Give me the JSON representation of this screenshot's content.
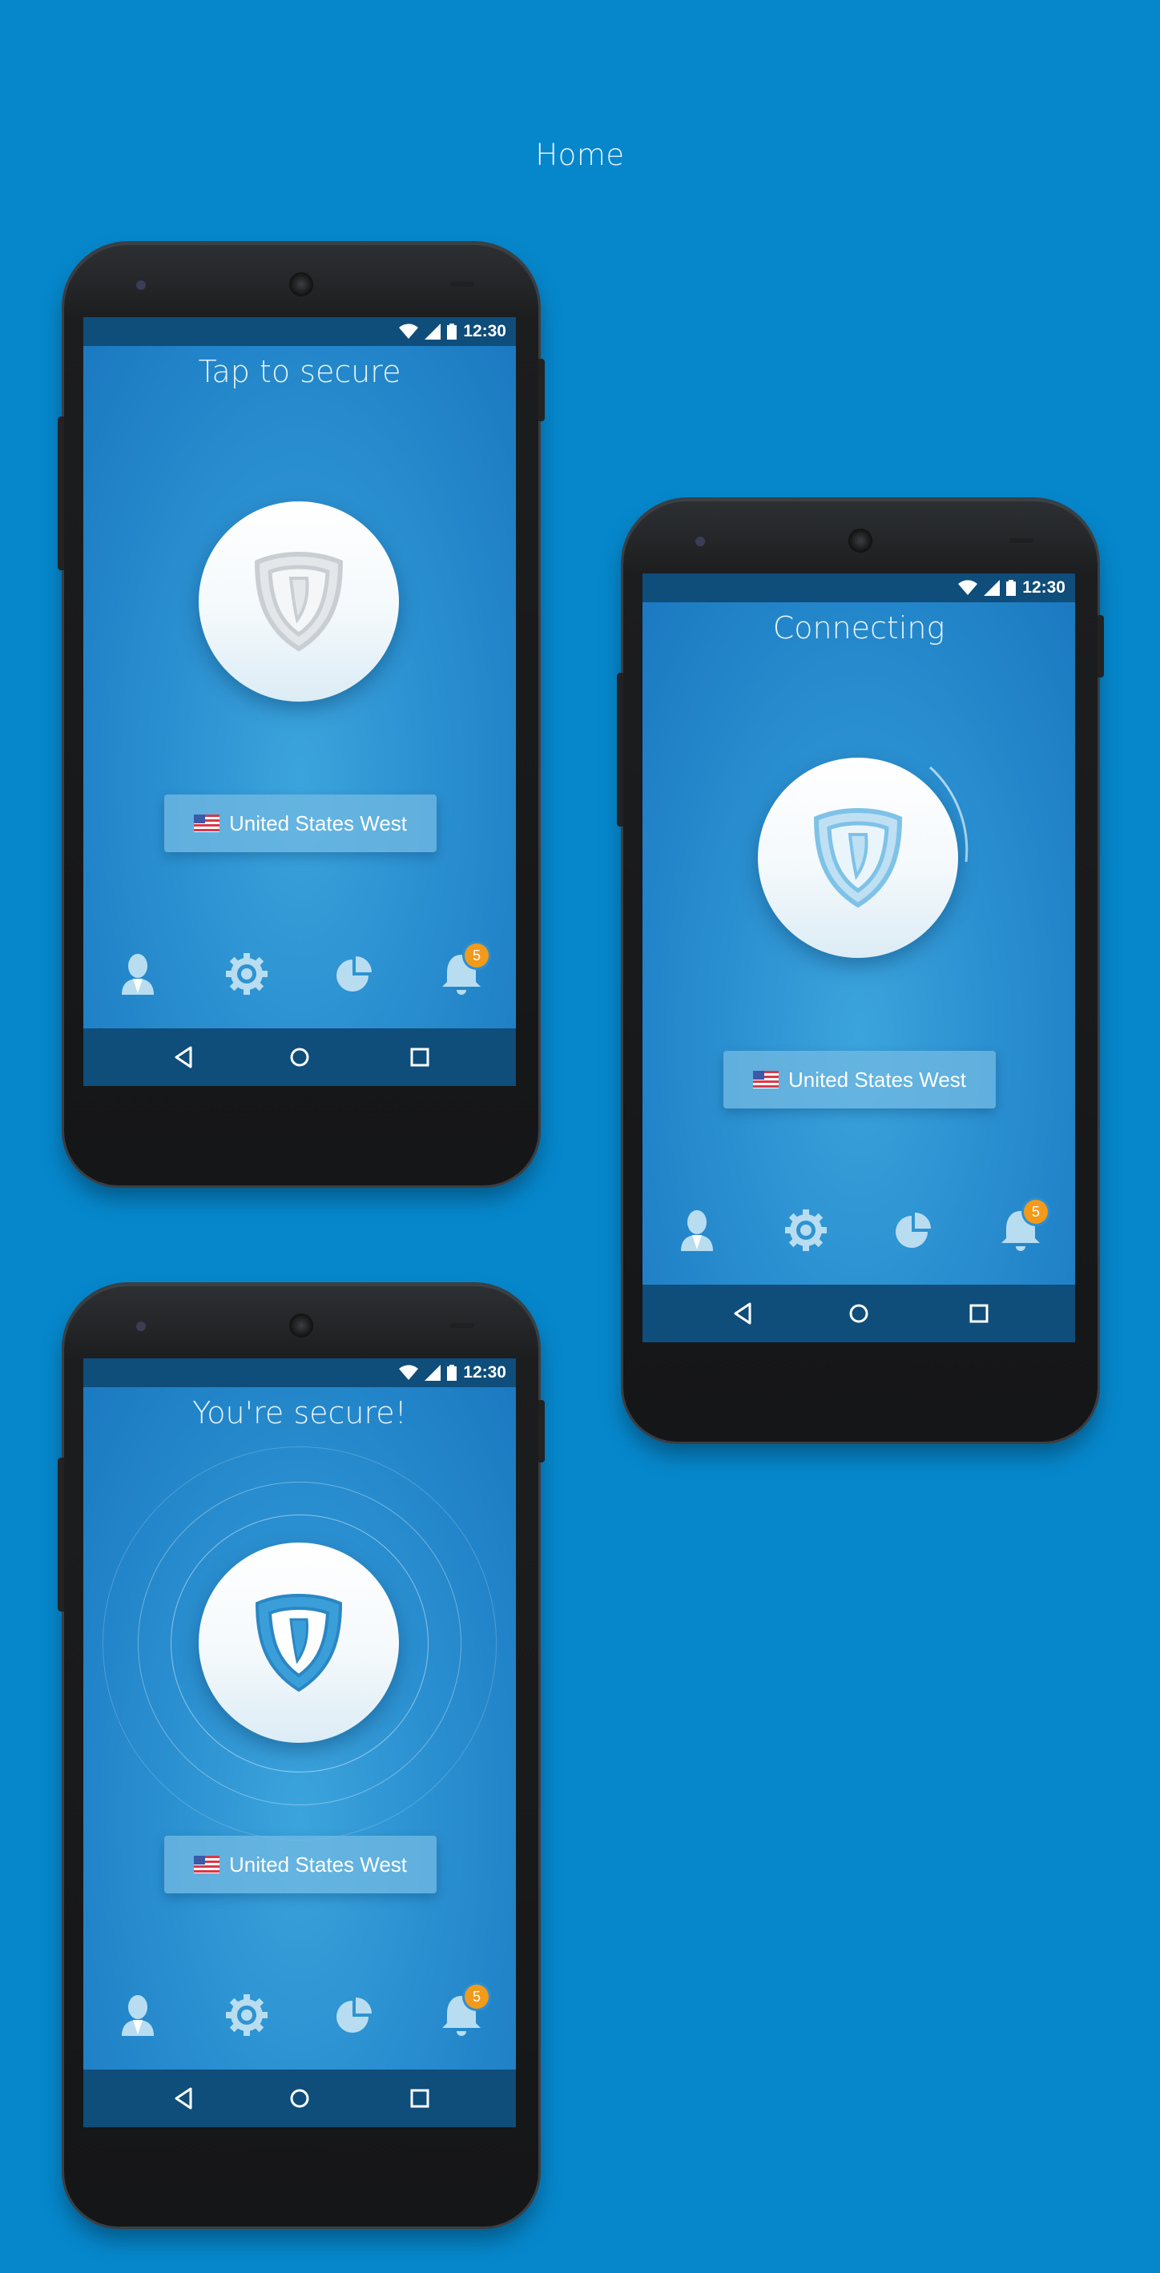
{
  "page": {
    "title": "Home"
  },
  "status": {
    "time": "12:30"
  },
  "screens": [
    {
      "title": "Tap to secure",
      "location": "United States West",
      "badge": "5"
    },
    {
      "title": "Connecting",
      "location": "United States West",
      "badge": "5"
    },
    {
      "title": "You're secure!",
      "location": "United States West",
      "badge": "5"
    }
  ],
  "icons": {
    "shield": "shield-icon",
    "account": "account-icon",
    "settings": "gear-icon",
    "stats": "pie-chart-icon",
    "notifications": "bell-icon",
    "back": "back-icon",
    "home": "home-icon",
    "recents": "recents-icon",
    "flag": "us-flag-icon"
  },
  "colors": {
    "background": "#0687cc",
    "shield_inactive": "#c9ced3",
    "shield_active": "#3a9fd8",
    "badge": "#f39a1a",
    "bars": "#0f4d7a"
  }
}
